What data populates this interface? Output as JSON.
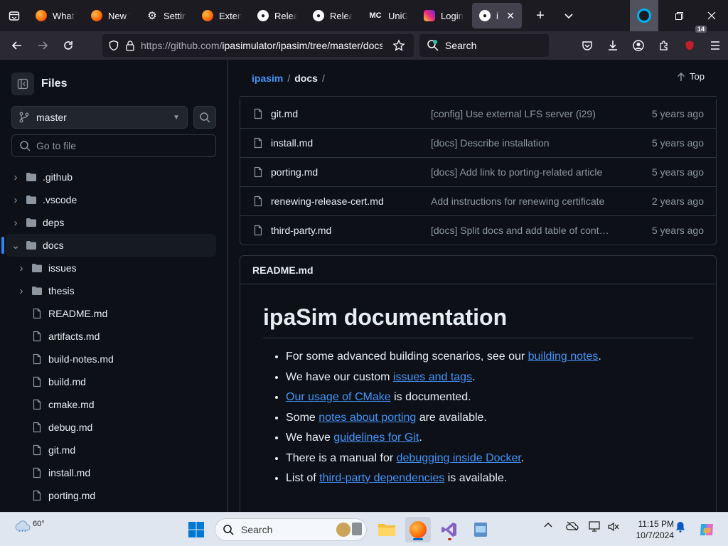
{
  "browser": {
    "tabs": [
      {
        "label": "What's",
        "icon": "firefox-icon",
        "active": false
      },
      {
        "label": "New Tab",
        "icon": "firefox-icon",
        "active": false
      },
      {
        "label": "Settings",
        "icon": "gear-icon",
        "active": false
      },
      {
        "label": "Extensions",
        "icon": "firefox-icon",
        "active": false
      },
      {
        "label": "Releases",
        "icon": "github-icon",
        "active": false
      },
      {
        "label": "Releases",
        "icon": "github-icon",
        "active": false
      },
      {
        "label": "UniGet",
        "icon": "mc-icon",
        "active": false
      },
      {
        "label": "Login",
        "icon": "instagram-icon",
        "active": false
      },
      {
        "label": "ipa",
        "icon": "github-icon",
        "active": true
      }
    ],
    "new_tab_symbol": "+",
    "url": {
      "host": "https://github.com/",
      "path": "ipasimulator/ipasim/tree/master/docs"
    },
    "search_placeholder": "Search",
    "extensions_badge": "14"
  },
  "sidebar": {
    "title": "Files",
    "branch": "master",
    "goto_placeholder": "Go to file",
    "tree": [
      {
        "label": ".github",
        "type": "folder",
        "depth": 0,
        "expanded": false,
        "selected": false
      },
      {
        "label": ".vscode",
        "type": "folder",
        "depth": 0,
        "expanded": false,
        "selected": false
      },
      {
        "label": "deps",
        "type": "folder",
        "depth": 0,
        "expanded": false,
        "selected": false
      },
      {
        "label": "docs",
        "type": "folder",
        "depth": 0,
        "expanded": true,
        "selected": true
      },
      {
        "label": "issues",
        "type": "folder",
        "depth": 1,
        "expanded": false,
        "selected": false
      },
      {
        "label": "thesis",
        "type": "folder",
        "depth": 1,
        "expanded": false,
        "selected": false
      },
      {
        "label": "README.md",
        "type": "file",
        "depth": 1,
        "selected": false
      },
      {
        "label": "artifacts.md",
        "type": "file",
        "depth": 1,
        "selected": false
      },
      {
        "label": "build-notes.md",
        "type": "file",
        "depth": 1,
        "selected": false
      },
      {
        "label": "build.md",
        "type": "file",
        "depth": 1,
        "selected": false
      },
      {
        "label": "cmake.md",
        "type": "file",
        "depth": 1,
        "selected": false
      },
      {
        "label": "debug.md",
        "type": "file",
        "depth": 1,
        "selected": false
      },
      {
        "label": "git.md",
        "type": "file",
        "depth": 1,
        "selected": false
      },
      {
        "label": "install.md",
        "type": "file",
        "depth": 1,
        "selected": false
      },
      {
        "label": "porting.md",
        "type": "file",
        "depth": 1,
        "selected": false
      }
    ]
  },
  "breadcrumb": {
    "repo": "ipasim",
    "sep": "/",
    "current": "docs",
    "top_label": "Top"
  },
  "files": [
    {
      "name": "git.md",
      "message": "[config] Use external LFS server (i29)",
      "date": "5 years ago"
    },
    {
      "name": "install.md",
      "message": "[docs] Describe installation",
      "date": "5 years ago"
    },
    {
      "name": "porting.md",
      "message": "[docs] Add link to porting-related article",
      "date": "5 years ago"
    },
    {
      "name": "renewing-release-cert.md",
      "message": "Add instructions for renewing certificate",
      "date": "2 years ago"
    },
    {
      "name": "third-party.md",
      "message": "[docs] Split docs and add table of cont…",
      "date": "5 years ago"
    }
  ],
  "readme": {
    "filename": "README.md",
    "heading": "ipaSim documentation",
    "items": [
      {
        "before": "For some advanced building scenarios, see our ",
        "link": "building notes",
        "after": "."
      },
      {
        "before": "We have our custom ",
        "link": "issues and tags",
        "after": "."
      },
      {
        "before": "",
        "link": "Our usage of CMake",
        "after": " is documented."
      },
      {
        "before": "Some ",
        "link": "notes about porting",
        "after": " are available."
      },
      {
        "before": "We have ",
        "link": "guidelines for Git",
        "after": "."
      },
      {
        "before": "There is a manual for ",
        "link": "debugging inside Docker",
        "after": "."
      },
      {
        "before": "List of ",
        "link": "third-party dependencies",
        "after": " is available."
      }
    ]
  },
  "taskbar": {
    "weather_temp": "60°",
    "search_label": "Search",
    "time": "11:15 PM",
    "date": "10/7/2024"
  },
  "colors": {
    "accent": "#4493f8",
    "background": "#0d1117",
    "border": "#30363d",
    "muted": "#8d96a0"
  }
}
